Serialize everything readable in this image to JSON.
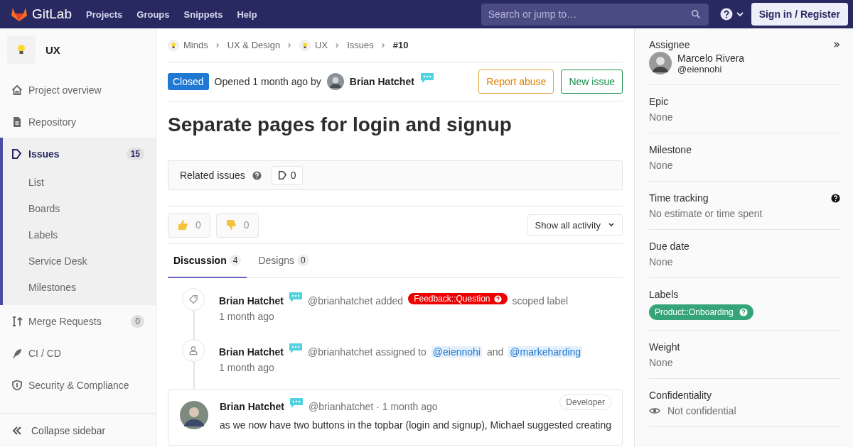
{
  "topbar": {
    "brand": "GitLab",
    "nav": [
      "Projects",
      "Groups",
      "Snippets",
      "Help"
    ],
    "search": {
      "placeholder": "Search or jump to…"
    },
    "sign_in": "Sign in / Register"
  },
  "sidebar": {
    "project": "UX",
    "items": [
      {
        "label": "Project overview",
        "selected": false
      },
      {
        "label": "Repository",
        "selected": false
      },
      {
        "label": "Issues",
        "count": "15",
        "selected": true,
        "children": [
          {
            "label": "List"
          },
          {
            "label": "Boards"
          },
          {
            "label": "Labels"
          },
          {
            "label": "Service Desk"
          },
          {
            "label": "Milestones"
          }
        ]
      },
      {
        "label": "Merge Requests",
        "count": "0",
        "selected": false
      },
      {
        "label": "CI / CD",
        "selected": false
      },
      {
        "label": "Security & Compliance",
        "selected": false
      }
    ],
    "collapse": "Collapse sidebar"
  },
  "breadcrumbs": [
    {
      "label": "Minds",
      "avatar": true,
      "current": false
    },
    {
      "label": "UX & Design",
      "avatar": false,
      "current": false
    },
    {
      "label": "UX",
      "avatar": true,
      "current": false
    },
    {
      "label": "Issues",
      "avatar": false,
      "current": false
    },
    {
      "label": "#10",
      "avatar": false,
      "current": true
    }
  ],
  "issue": {
    "status": "Closed",
    "opened": "Opened 1 month ago by",
    "author": "Brian Hatchet",
    "actions": [
      {
        "label": "Report abuse",
        "kind": "warning"
      },
      {
        "label": "New issue",
        "kind": "success"
      }
    ],
    "title": "Separate pages for login and signup"
  },
  "related": {
    "label": "Related issues",
    "count": "0"
  },
  "awards": [
    {
      "kind": "thumbsup",
      "count": "0"
    },
    {
      "kind": "thumbsdown",
      "count": "0"
    }
  ],
  "activity_filter": "Show all activity",
  "tabs": [
    {
      "label": "Discussion",
      "count": "4",
      "selected": true
    },
    {
      "label": "Designs",
      "count": "0",
      "selected": false
    }
  ],
  "timeline": [
    {
      "kind": "label",
      "author": "Brian Hatchet",
      "time": "1 month ago",
      "parts": [
        {
          "kind": "text",
          "text": "@brianhatchet added"
        },
        {
          "kind": "label",
          "text": "Feedback::Question",
          "color": "#ec0000"
        },
        {
          "kind": "text",
          "text": "scoped label"
        }
      ]
    },
    {
      "kind": "assign",
      "author": "Brian Hatchet",
      "time": "1 month ago",
      "parts": [
        {
          "kind": "text",
          "text": "@brianhatchet assigned to"
        },
        {
          "kind": "mention",
          "text": "@eiennohi"
        },
        {
          "kind": "text",
          "text": "and"
        },
        {
          "kind": "mention",
          "text": "@markeharding"
        }
      ]
    }
  ],
  "comment": {
    "author": "Brian Hatchet",
    "meta": "@brianhatchet · 1 month ago",
    "role": "Developer",
    "body": "as we now have two buttons in the topbar (login and signup), Michael suggested creating"
  },
  "right_sidebar": {
    "assignee": {
      "title": "Assignee",
      "name": "Marcelo Rivera",
      "handle": "@eiennohi"
    },
    "blocks": [
      {
        "kind": "text",
        "title": "Epic",
        "value": "None",
        "help": false
      },
      {
        "kind": "text",
        "title": "Milestone",
        "value": "None",
        "help": false
      },
      {
        "kind": "text",
        "title": "Time tracking",
        "value": "No estimate or time spent",
        "help": true
      },
      {
        "kind": "text",
        "title": "Due date",
        "value": "None",
        "help": false
      },
      {
        "kind": "labels",
        "title": "Labels",
        "labels": [
          {
            "text": "Product::Onboarding",
            "color": "#36a479"
          }
        ],
        "help": false
      },
      {
        "kind": "text",
        "title": "Weight",
        "value": "None",
        "help": false
      },
      {
        "kind": "confidential",
        "title": "Confidentiality",
        "value": "Not confidential",
        "help": false
      }
    ]
  }
}
